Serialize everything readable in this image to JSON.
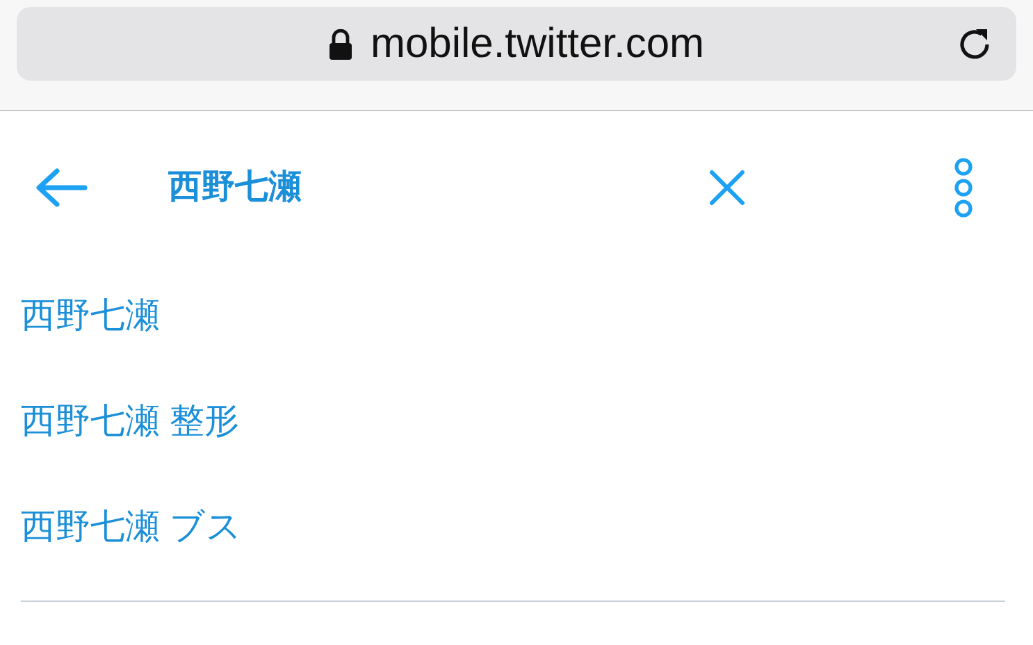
{
  "browser": {
    "url": "mobile.twitter.com"
  },
  "search": {
    "value": "西野七瀬"
  },
  "suggestions": [
    "西野七瀬",
    "西野七瀬 整形",
    "西野七瀬 ブス"
  ]
}
